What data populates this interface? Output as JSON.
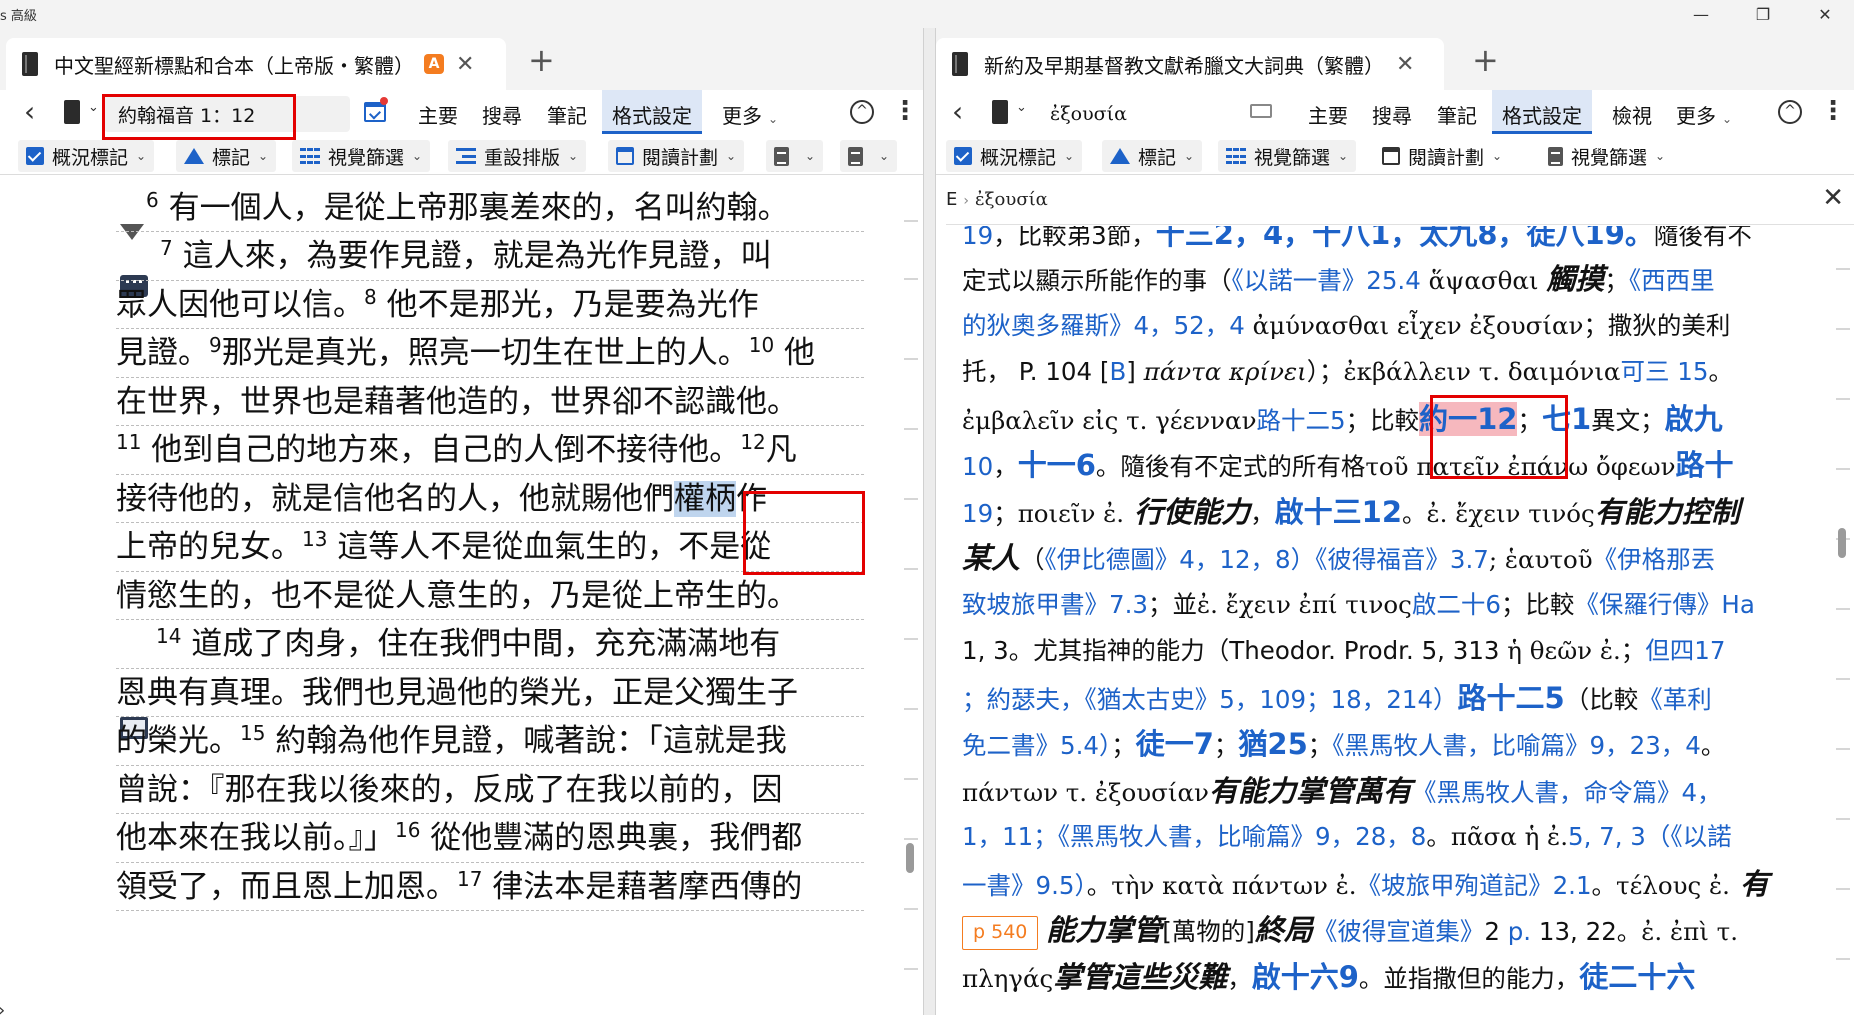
{
  "window": {
    "title": "s 高級",
    "controls": {
      "minimize": "—",
      "maximize": "❐",
      "close": "✕"
    }
  },
  "left": {
    "tab": {
      "title": "中文聖經新標點和合本（上帝版・繁體）",
      "badge": "A",
      "close": "✕",
      "new_tab": "+"
    },
    "nav": {
      "back": "‹",
      "caret": "⌄",
      "reference": "約翰福音 1：12"
    },
    "menu": [
      {
        "label": "主要"
      },
      {
        "label": "搜尋"
      },
      {
        "label": "筆記"
      },
      {
        "label": "格式設定",
        "active": true
      },
      {
        "label": "更多",
        "caret": "⌄"
      }
    ],
    "toolbar2": [
      {
        "label": "概況標記",
        "caret": "⌄",
        "icon": "check-box-icon"
      },
      {
        "label": "標記",
        "caret": "⌄",
        "icon": "highlight-triangle-icon"
      },
      {
        "label": "視覺篩選",
        "caret": "⌄",
        "icon": "visual-filter-icon"
      },
      {
        "label": "重設排版",
        "caret": "⌄",
        "icon": "reflow-icon"
      },
      {
        "label": "閱讀計劃",
        "caret": "⌄",
        "icon": "calendar-icon"
      }
    ],
    "toolbar2_extra": {
      "caret": "⌄"
    },
    "text_lines": [
      {
        "pre": "",
        "v": "6",
        "text": " 有一個人，是從上帝那裏差來的，名叫約翰。"
      },
      {
        "pre": "",
        "v": "7",
        "text": " 這人來，為要作見證，就是為光作見證，叫"
      },
      {
        "pre": "眾人因他可以信。",
        "v": "8",
        "text": " 他不是那光，乃是要為光作"
      },
      {
        "pre": "見證。",
        "v": "9",
        "text": "那光是真光，照亮一切生在世上的人。",
        "v2": "10",
        "text2": " 他"
      },
      {
        "pre": "在世界，世界也是藉著他造的，世界卻不認識他。"
      },
      {
        "pre": "",
        "v": "11",
        "text": " 他到自己的地方來，自己的人倒不接待他。",
        "v2": "12",
        "text2": "凡"
      },
      {
        "pre": "接待他的，就是信他名的人，他就賜他們",
        "hl": "權柄",
        "post": "作"
      },
      {
        "pre": "上帝的兒女。",
        "v": "13",
        "text": " 這等人不是從血氣生的，不是從"
      },
      {
        "pre": "情慾生的，也不是從人意生的，乃是從上帝生的。"
      },
      {
        "pre": "",
        "v": "14",
        "text": " 道成了肉身，住在我們中間，充充滿滿地有"
      },
      {
        "pre": "恩典有真理。我們也見過他的榮光，正是父獨生子"
      },
      {
        "pre": "的榮光。",
        "v": "15",
        "text": " 約翰為他作見證，喊著說：「這就是我"
      },
      {
        "pre": "曾說：『那在我以後來的，反成了在我以前的，因"
      },
      {
        "pre": "他本來在我以前。』」",
        "v": "16",
        "text": " 從他豐滿的恩典裏，我們都"
      },
      {
        "pre": "領受了，而且恩上加恩。",
        "v": "17",
        "text": " 律法本是藉著摩西傳的"
      }
    ]
  },
  "right": {
    "tab": {
      "title": "新約及早期基督教文獻希臘文大詞典（繁體）",
      "close": "✕",
      "new_tab": "+"
    },
    "nav": {
      "back": "‹",
      "caret": "⌄",
      "search_value": "ἐξουσία"
    },
    "menu": [
      {
        "label": "主要"
      },
      {
        "label": "搜尋"
      },
      {
        "label": "筆記"
      },
      {
        "label": "格式設定",
        "active": true
      },
      {
        "label": "檢視"
      },
      {
        "label": "更多",
        "caret": "⌄"
      }
    ],
    "toolbar2": [
      {
        "label": "概況標記",
        "caret": "⌄",
        "icon": "check-box-icon"
      },
      {
        "label": "標記",
        "caret": "⌄",
        "icon": "highlight-triangle-icon"
      },
      {
        "label": "視覺篩選",
        "caret": "⌄",
        "icon": "visual-filter-icon"
      },
      {
        "label": "閱讀計劃",
        "caret": "⌄",
        "icon": "calendar-icon"
      },
      {
        "label": "視覺篩選",
        "caret": "⌄",
        "icon": "document-icon"
      }
    ],
    "breadcrumb": {
      "root": "E",
      "sep": "›",
      "current": "ἐξουσία",
      "close": "✕"
    },
    "lex": {
      "l1": {
        "a": "19",
        "b": "，比較弟3節，",
        "c": "十三2，4，",
        "d": "十八1，",
        "e": "太九8，",
        "f": "徒八19。",
        "g": "隨後有不"
      },
      "l2": {
        "a": "定式以顯示所能作的事（",
        "b": "《以諾一書》25.4",
        "c": " ἅψασθαι ",
        "d": "觸摸",
        "e": "；",
        "f": "《西西里"
      },
      "l3": {
        "a": "的狄奧多羅斯》4，52，4",
        "b": " ἀμύνασθαι εἶχεν ἐξουσίαν",
        "c": "；撒狄的美利"
      },
      "l4": {
        "a": "托， P. 104 [",
        "b": "B",
        "c": "] ",
        "d": "πάντα κρίνει",
        "e": "）；",
        "f": "ἐκβάλλειν τ. δαιμόνια",
        "g": "可三 15",
        "h": "。"
      },
      "l5": {
        "a": "ἐμβαλεῖν εἰς τ. γέενναν",
        "b": "路十二5",
        "c": "；比較",
        "d": "約一12",
        "e": "；",
        "f": "七1",
        "g": "異文；",
        "h": "啟九"
      },
      "l6": {
        "a": "10",
        "b": "，",
        "c": "十一6",
        "d": "。隨後有不定式的所有格",
        "e": "τοῦ πατεῖν ἐπάνω ὄφεων",
        "f": "路十"
      },
      "l7": {
        "a": "19",
        "b": "；",
        "c": "ποιεῖν ἐ.",
        "d": " 行使能力",
        "e": "，",
        "f": "啟十三12",
        "g": "。ἐ.",
        "h": " ἔχειν τινός",
        "i": "有能力控制"
      },
      "l8": {
        "a": "某人",
        "b": "（",
        "c": "《伊比德圖》4，12，8）",
        "d": "《彼得福音》3.7",
        "e": "; ἑαυτοῦ",
        "f": "《伊格那丟"
      },
      "l9": {
        "a": "致坡旅甲書》7.3",
        "b": "；並",
        "c": "ἐ. ἔχειν ἐπί τινος",
        "d": "啟二十6",
        "e": "；比較",
        "f": "《保羅行傳》Ha"
      },
      "l10": {
        "a": "1, 3。尤其指神的能力（Theodor. Prodr. 5, 313 ",
        "b": "ἡ θεῶν ἐ.",
        "c": "；",
        "d": "但四17"
      },
      "l11": {
        "a": "；約瑟夫，",
        "b": "《猶太古史》5，109；18，214）",
        "c": "路十二5",
        "d": "（比較",
        "e": "《革利"
      },
      "l12": {
        "a": "免二書》5.4）",
        "b": "；",
        "c": "徒一7",
        "d": "；",
        "e": "猶25",
        "f": "；",
        "g": "《黑馬牧人書，比喻篇》9，23，4",
        "h": "。"
      },
      "l13": {
        "a": "πάντων τ. ἐξουσίαν",
        "b": "有能力掌管萬有",
        "c": "《黑馬牧人書，命令篇》4，"
      },
      "l14": {
        "a": "1，11；",
        "b": "《黑馬牧人書，比喻篇》9，28，8",
        "c": "。",
        "d": "πᾶσα ἡ ἐ.",
        "e": "5, 7, 3",
        "f": "（",
        "g": "《以諾"
      },
      "l15": {
        "a": "一書》9.5）",
        "b": "。",
        "c": "τὴν κατὰ πάντων ἐ.",
        "d": "《坡旅甲殉道記》2.1",
        "e": "。",
        "f": "τέλους ἐ.",
        "g": " 有"
      },
      "l16": {
        "page": "p 540",
        "a": "能力掌管",
        "b": "[萬物的]",
        "c": "終局",
        "d": "《彼得宣道集》",
        "e": "2",
        "f": " p.",
        "g": " 13, 22。",
        "h": "ἐ. ἐπὶ τ."
      },
      "l17": {
        "a": "πληγάς",
        "b": "掌管這些災難",
        "c": "，",
        "d": "啟十六9",
        "e": "。並指撒但的能力，",
        "f": "徒二十六"
      }
    }
  },
  "colors": {
    "accent": "#1d62c8",
    "highlight_blue": "#bfd5ee",
    "highlight_pink": "#f6b8be",
    "annotation_red": "#e30000",
    "badge_orange": "#f47c20"
  },
  "misc": {
    "collapse_arrow": "›"
  }
}
